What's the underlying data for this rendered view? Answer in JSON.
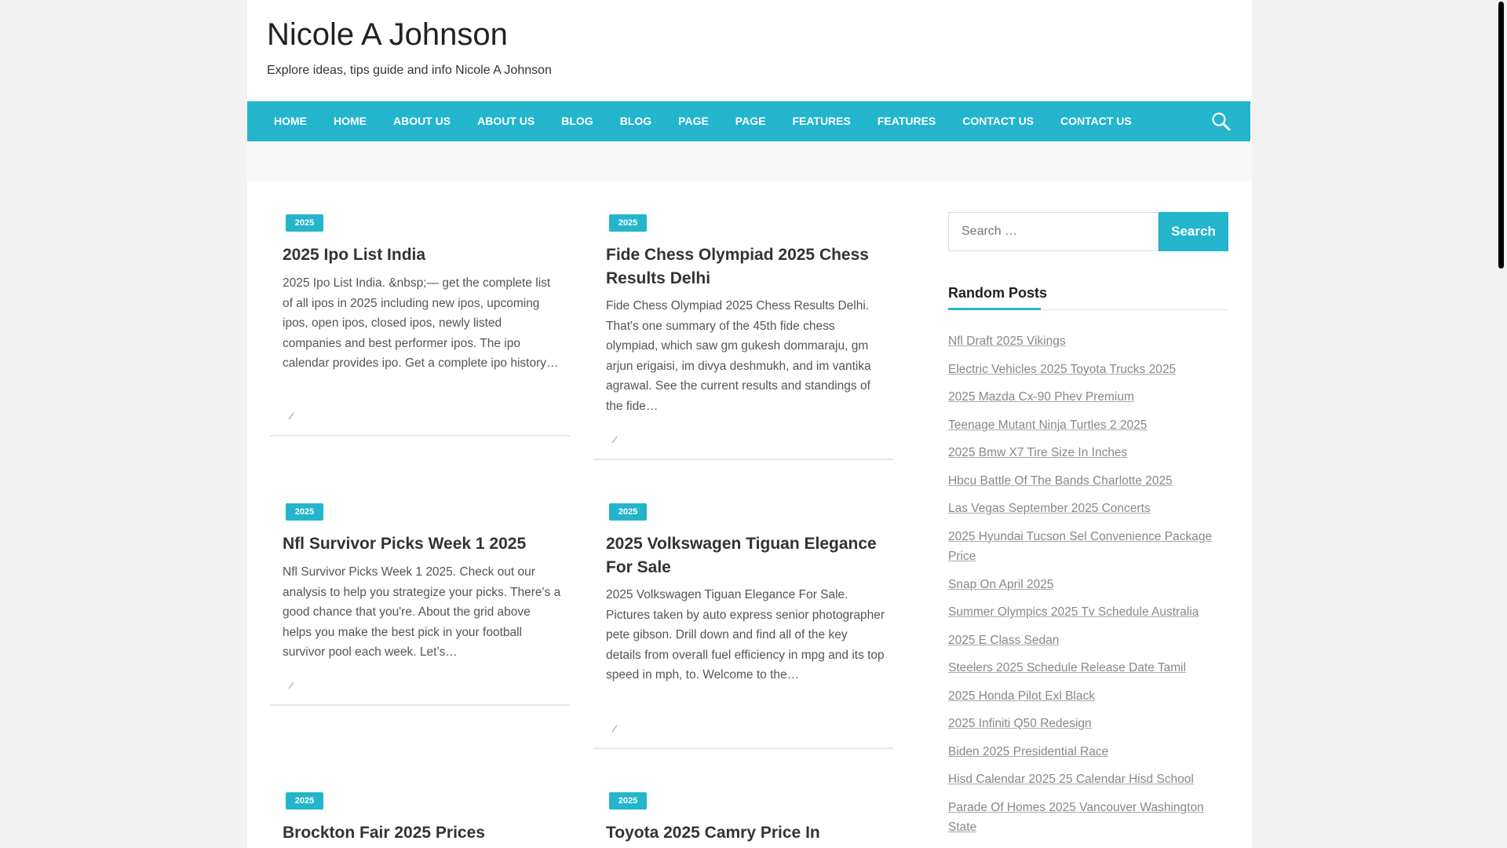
{
  "site": {
    "title": "Nicole A Johnson",
    "description": "Explore ideas, tips guide and info Nicole A Johnson"
  },
  "nav": {
    "items": [
      "HOME",
      "HOME",
      "ABOUT US",
      "ABOUT US",
      "BLOG",
      "BLOG",
      "PAGE",
      "PAGE",
      "FEATURES",
      "FEATURES",
      "CONTACT US",
      "CONTACT US"
    ],
    "search_icon": "search-icon"
  },
  "posts": [
    {
      "tag": "2025",
      "title": "2025 Ipo List India",
      "excerpt": "2025 Ipo List India. &nbsp;— get the complete list of all ipos in 2025 including new ipos, upcoming ipos, open ipos, closed ipos, newly listed companies and best performer ipos. The ipo calendar provides ipo. Get a complete ipo history…"
    },
    {
      "tag": "2025",
      "title": "Fide Chess Olympiad 2025 Chess Results Delhi",
      "excerpt": "Fide Chess Olympiad 2025 Chess Results Delhi. That's one summary of the 45th fide chess olympiad, which saw gm gukesh dommaraju, gm arjun erigaisi, im divya deshmukh, and im vantika agrawal. See the current results and standings of the fide…"
    },
    {
      "tag": "2025",
      "title": "Nfl Survivor Picks Week 1 2025",
      "excerpt": "Nfl Survivor Picks Week 1 2025. Check out our analysis to help you strategize your picks. There's a good chance that you're. About the grid above helps you make the best pick in your football survivor pool each week. Let’s…"
    },
    {
      "tag": "2025",
      "title": "2025 Volkswagen Tiguan Elegance For Sale",
      "excerpt": "2025 Volkswagen Tiguan Elegance For Sale. Pictures taken by auto express senior photographer pete gibson. Drill down and find all of the key details from overall fuel efficiency in mpg and its top speed in mph, to. Welcome to the…"
    },
    {
      "tag": "2025",
      "title": "Brockton Fair 2025 Prices",
      "excerpt": ""
    },
    {
      "tag": "2025",
      "title": "Toyota 2025 Camry Price In",
      "excerpt": ""
    }
  ],
  "sidebar": {
    "search_placeholder": "Search …",
    "search_button": "Search",
    "widget_title": "Random Posts",
    "random_posts": [
      "Nfl Draft 2025 Vikings",
      "Electric Vehicles 2025 Toyota Trucks 2025",
      "2025 Mazda Cx-90 Phev Premium",
      "Teenage Mutant Ninja Turtles 2 2025",
      "2025 Bmw X7 Tire Size In Inches",
      "Hbcu Battle Of The Bands Charlotte 2025",
      "Las Vegas September 2025 Concerts",
      "2025 Hyundai Tucson Sel Convenience Package Price",
      "Snap On April 2025",
      "Summer Olympics 2025 Tv Schedule Australia",
      "2025 E Class Sedan",
      "Steelers 2025 Schedule Release Date Tamil",
      "2025 Honda Pilot Exl Black",
      "2025 Infiniti Q50 Redesign",
      "Biden 2025 Presidential Race",
      "Hisd Calendar 2025 25 Calendar Hisd School",
      "Parade Of Homes 2025 Vancouver Washington State"
    ]
  },
  "colors": {
    "accent": "#23b5cc"
  }
}
